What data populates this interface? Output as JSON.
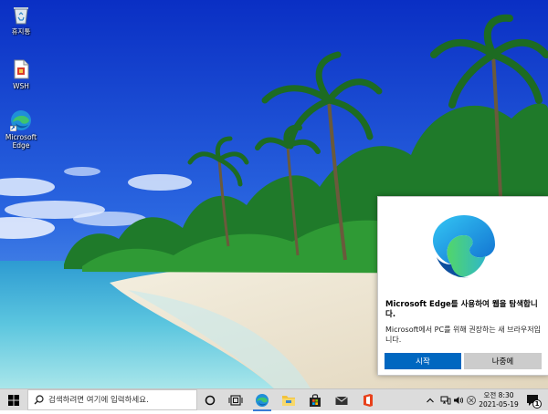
{
  "desktop": {
    "icons": [
      {
        "label": "휴지통",
        "icon": "recycle-bin-icon"
      },
      {
        "label": "WSH",
        "icon": "script-file-icon"
      },
      {
        "label": "Microsoft Edge",
        "icon": "edge-icon"
      }
    ]
  },
  "toast": {
    "title": "Microsoft  Edge를 사용하여 웹을 탐색합니다.",
    "description": "Microsoft에서 PC를 위해 권장하는 새 브라우저입니다.",
    "primary_label": "시작",
    "secondary_label": "나중에",
    "icon": "edge-logo-icon"
  },
  "taskbar": {
    "search_placeholder": "검색하려면 여기에 입력하세요.",
    "pinned": [
      "task-view-icon",
      "edge-icon",
      "file-explorer-icon",
      "store-icon",
      "mail-icon",
      "office-icon"
    ],
    "clock": {
      "time": "오전 8:30",
      "date": "2021-05-19"
    },
    "notification_count": "1"
  },
  "colors": {
    "accent": "#0067c0",
    "taskbar": "#dcdcdc",
    "secondary_button": "#cccccc"
  }
}
